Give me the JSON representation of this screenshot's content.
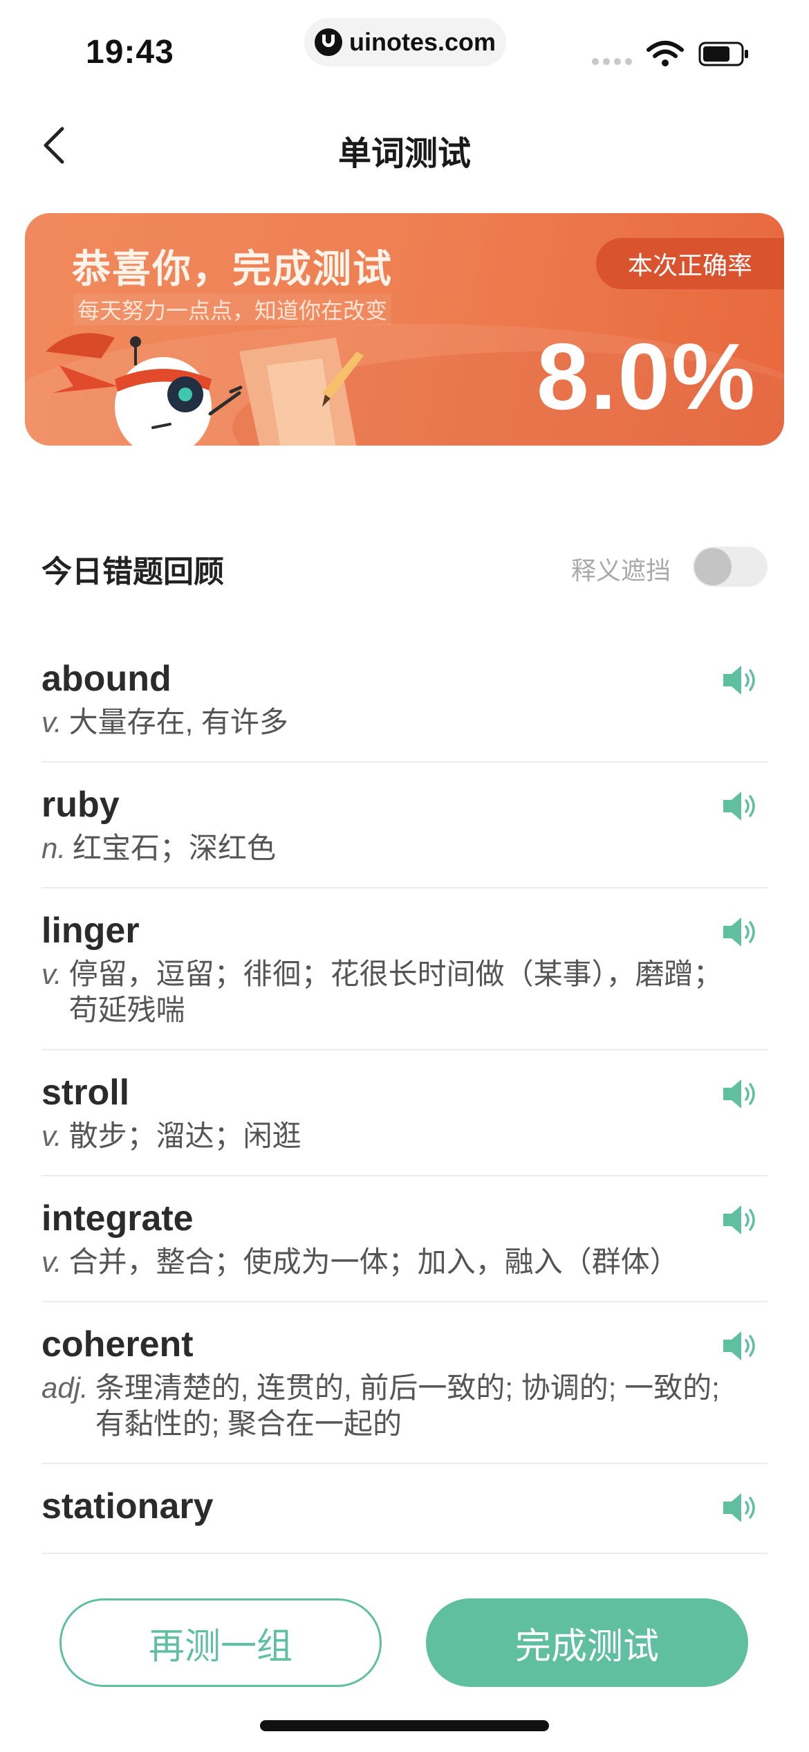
{
  "status_bar": {
    "time": "19:43",
    "url": "uinotes.com"
  },
  "nav": {
    "title": "单词测试"
  },
  "banner": {
    "title": "恭喜你，完成测试",
    "subtitle": "每天努力一点点，知道你在改变",
    "badge": "本次正确率",
    "accuracy": "8.0%"
  },
  "review": {
    "title": "今日错题回顾",
    "toggle_label": "释义遮挡",
    "toggle_on": false
  },
  "words": [
    {
      "word": "abound",
      "pos": "v.",
      "def": "大量存在, 有许多"
    },
    {
      "word": "ruby",
      "pos": "n.",
      "def": "红宝石；深红色"
    },
    {
      "word": "linger",
      "pos": "v.",
      "def": "停留，逗留；徘徊；花很长时间做（某事），磨蹭；苟延残喘"
    },
    {
      "word": "stroll",
      "pos": "v.",
      "def": "散步；溜达；闲逛"
    },
    {
      "word": "integrate",
      "pos": "v.",
      "def": "合并，整合；使成为一体；加入，融入（群体）"
    },
    {
      "word": "coherent",
      "pos": "adj.",
      "def": "条理清楚的, 连贯的, 前后一致的; 协调的; 一致的; 有黏性的; 聚合在一起的"
    },
    {
      "word": "stationary",
      "pos": "",
      "def": ""
    }
  ],
  "buttons": {
    "again": "再测一组",
    "finish": "完成测试"
  },
  "colors": {
    "accent": "#5fbf9f",
    "banner": "#ee7f52"
  },
  "icons": {
    "back": "chevron-left-icon",
    "speaker": "speaker-icon"
  }
}
